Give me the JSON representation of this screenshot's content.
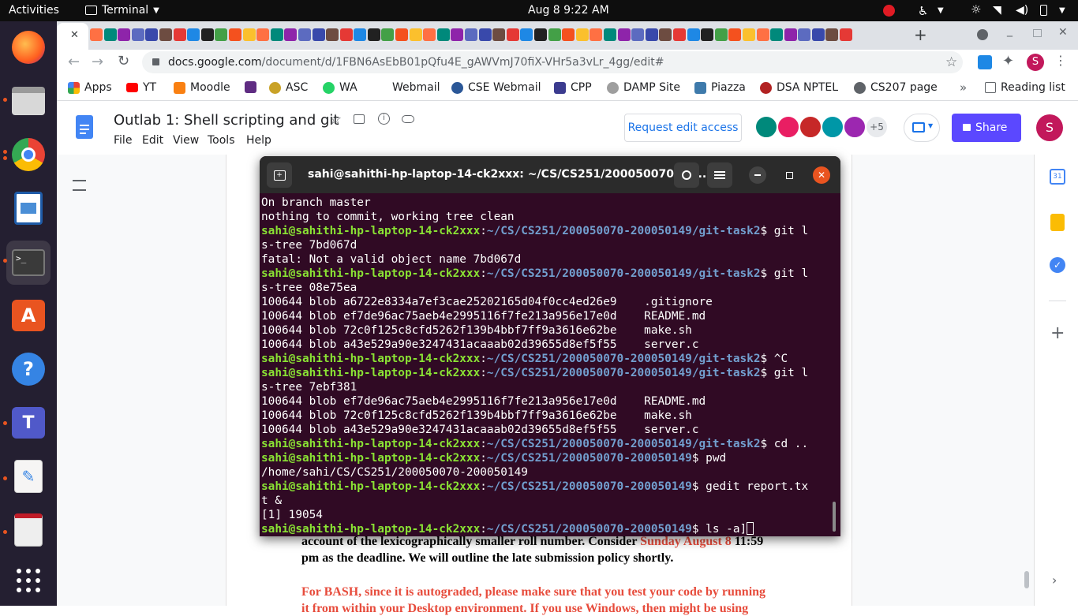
{
  "topbar": {
    "activities": "Activities",
    "app_name": "Terminal",
    "clock": "Aug 8  9:22 AM"
  },
  "browser": {
    "url_domain": "docs.google.com",
    "url_path": "/document/d/1FBN6AsEbB01pQfu4E_gAWVmJ70fiX-VHr5a3vLr_4gg/edit#",
    "profile_initial": "S"
  },
  "bookmarks": [
    {
      "label": "Apps",
      "color": "#ea4335"
    },
    {
      "label": "YT",
      "color": "#ff0000"
    },
    {
      "label": "Moodle",
      "color": "#f98012"
    },
    {
      "label": "",
      "color": "#5f2c82"
    },
    {
      "label": "ASC",
      "color": "#c9a227"
    },
    {
      "label": "WA",
      "color": "#25d366"
    },
    {
      "label": "Webmail",
      "color": "#ffffff"
    },
    {
      "label": "CSE Webmail",
      "color": "#2b5797"
    },
    {
      "label": "CPP",
      "color": "#3b3b8f"
    },
    {
      "label": "DAMP Site",
      "color": "#9e9e9e"
    },
    {
      "label": "Piazza",
      "color": "#3e7aab"
    },
    {
      "label": "DSA NPTEL",
      "color": "#b22222"
    },
    {
      "label": "CS207 page",
      "color": "#5f6368"
    }
  ],
  "reading_list": "Reading list",
  "docs": {
    "title": "Outlab 1: Shell scripting and git",
    "menu": [
      "File",
      "Edit",
      "View",
      "Tools",
      "Help"
    ],
    "request_access": "Request edit access",
    "more_count": "+5",
    "share_label": "Share",
    "user_initial": "S"
  },
  "terminal": {
    "title": "sahi@sahithi-hp-laptop-14-ck2xxx: ~/CS/CS251/200050070-20...",
    "lines": [
      {
        "t": "out",
        "text": "On branch master"
      },
      {
        "t": "out",
        "text": "nothing to commit, working tree clean"
      },
      {
        "t": "prompt",
        "user": "sahi@sahithi-hp-laptop-14-ck2xxx",
        "path": "~/CS/CS251/200050070-200050149/git-task2",
        "cmd": "$ git l"
      },
      {
        "t": "out",
        "text": "s-tree 7bd067d"
      },
      {
        "t": "out",
        "text": "fatal: Not a valid object name 7bd067d"
      },
      {
        "t": "prompt",
        "user": "sahi@sahithi-hp-laptop-14-ck2xxx",
        "path": "~/CS/CS251/200050070-200050149/git-task2",
        "cmd": "$ git l"
      },
      {
        "t": "out",
        "text": "s-tree 08e75ea"
      },
      {
        "t": "out",
        "text": "100644 blob a6722e8334a7ef3cae25202165d04f0cc4ed26e9    .gitignore"
      },
      {
        "t": "out",
        "text": "100644 blob ef7de96ac75aeb4e2995116f7fe213a956e17e0d    README.md"
      },
      {
        "t": "out",
        "text": "100644 blob 72c0f125c8cfd5262f139b4bbf7ff9a3616e62be    make.sh"
      },
      {
        "t": "out",
        "text": "100644 blob a43e529a90e3247431acaaab02d39655d8ef5f55    server.c"
      },
      {
        "t": "prompt",
        "user": "sahi@sahithi-hp-laptop-14-ck2xxx",
        "path": "~/CS/CS251/200050070-200050149/git-task2",
        "cmd": "$ ^C"
      },
      {
        "t": "prompt",
        "user": "sahi@sahithi-hp-laptop-14-ck2xxx",
        "path": "~/CS/CS251/200050070-200050149/git-task2",
        "cmd": "$ git l"
      },
      {
        "t": "out",
        "text": "s-tree 7ebf381"
      },
      {
        "t": "out",
        "text": "100644 blob ef7de96ac75aeb4e2995116f7fe213a956e17e0d    README.md"
      },
      {
        "t": "out",
        "text": "100644 blob 72c0f125c8cfd5262f139b4bbf7ff9a3616e62be    make.sh"
      },
      {
        "t": "out",
        "text": "100644 blob a43e529a90e3247431acaaab02d39655d8ef5f55    server.c"
      },
      {
        "t": "prompt",
        "user": "sahi@sahithi-hp-laptop-14-ck2xxx",
        "path": "~/CS/CS251/200050070-200050149/git-task2",
        "cmd": "$ cd .."
      },
      {
        "t": "prompt",
        "user": "sahi@sahithi-hp-laptop-14-ck2xxx",
        "path": "~/CS/CS251/200050070-200050149",
        "cmd": "$ pwd"
      },
      {
        "t": "out",
        "text": "/home/sahi/CS/CS251/200050070-200050149"
      },
      {
        "t": "prompt",
        "user": "sahi@sahithi-hp-laptop-14-ck2xxx",
        "path": "~/CS/CS251/200050070-200050149",
        "cmd": "$ gedit report.tx"
      },
      {
        "t": "out",
        "text": "t &"
      },
      {
        "t": "out",
        "text": "[1] 19054"
      },
      {
        "t": "prompt",
        "user": "sahi@sahithi-hp-laptop-14-ck2xxx",
        "path": "~/CS/CS251/200050070-200050149",
        "cmd": "$ ls -a]"
      }
    ]
  },
  "doc_content": {
    "line1": "account of the lexicographically smaller roll number. Consider ",
    "line1_red": "Sunday August 8",
    "line1_end": " 11:59",
    "line2": "pm as the deadline. We will outline the late submission policy shortly.",
    "line3": "For BASH, since it is autograded, please make sure that you test your code by running",
    "line4": "it from within your Desktop environment. If you use Windows, then might be using"
  },
  "colors": {
    "accent_red": "#e74c3c",
    "share_blue": "#5b48ff"
  }
}
